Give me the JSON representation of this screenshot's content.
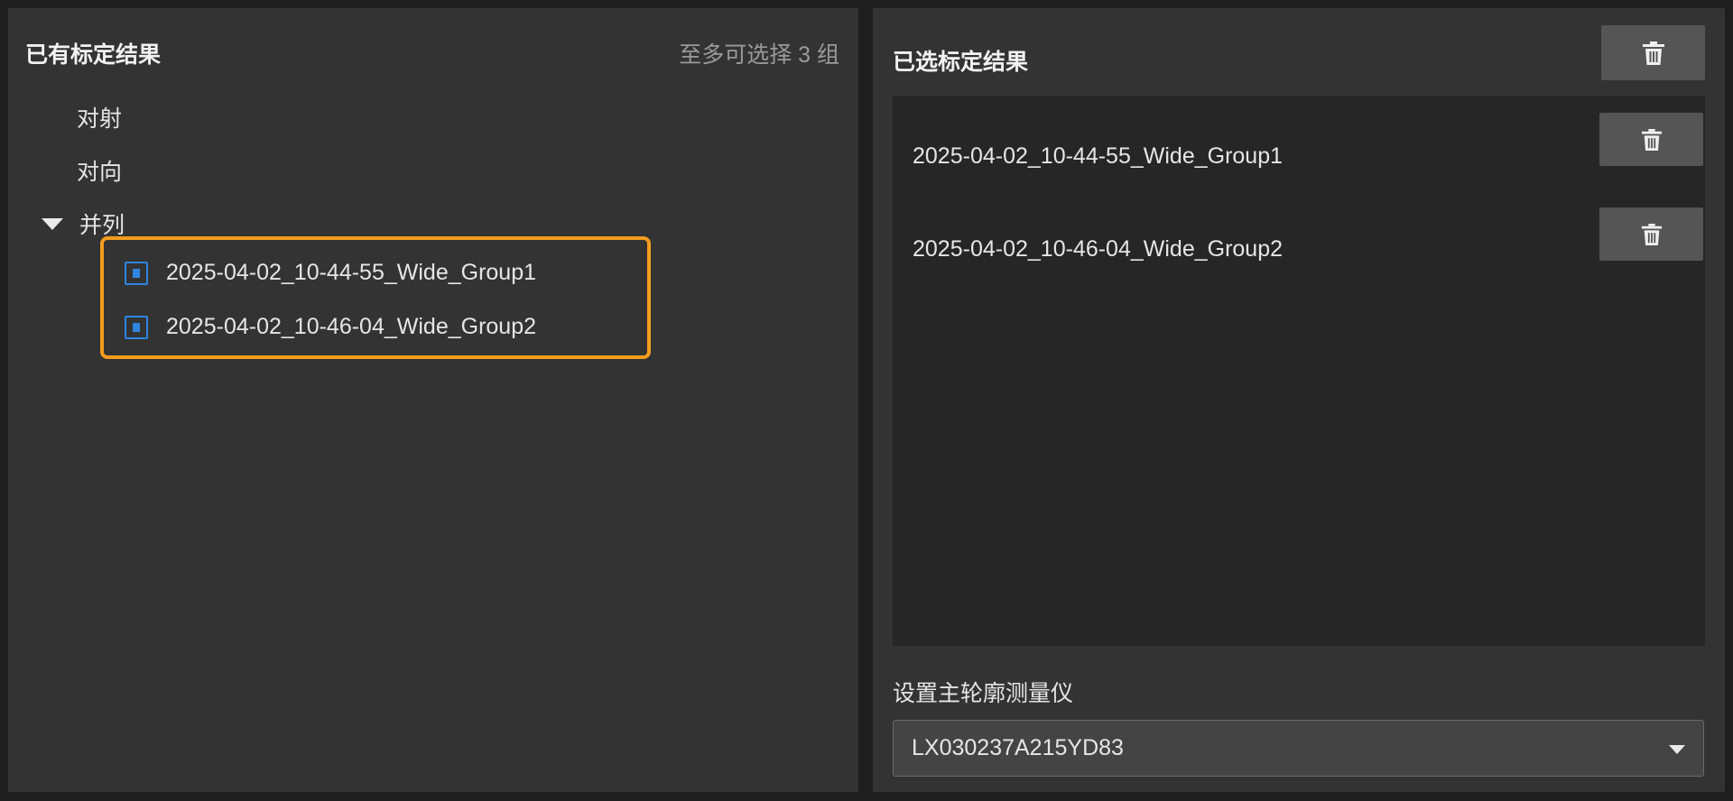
{
  "left": {
    "title": "已有标定结果",
    "hint": "至多可选择 3 组",
    "tree": {
      "leaf1": "对射",
      "leaf2": "对向",
      "parent": "并列",
      "children": [
        "2025-04-02_10-44-55_Wide_Group1",
        "2025-04-02_10-46-04_Wide_Group2"
      ]
    }
  },
  "right": {
    "title": "已选标定结果",
    "selected": [
      "2025-04-02_10-44-55_Wide_Group1",
      "2025-04-02_10-46-04_Wide_Group2"
    ],
    "profiler_label": "设置主轮廓测量仪",
    "profiler_value": "LX030237A215YD83"
  },
  "icons": {
    "delete": "trash-icon",
    "item": "result-item-icon",
    "expand": "caret-down-icon",
    "dropdown": "chevron-down-icon"
  },
  "colors": {
    "highlight": "#f39c1e",
    "item_icon": "#2f86e0",
    "panel_bg": "#333333"
  }
}
